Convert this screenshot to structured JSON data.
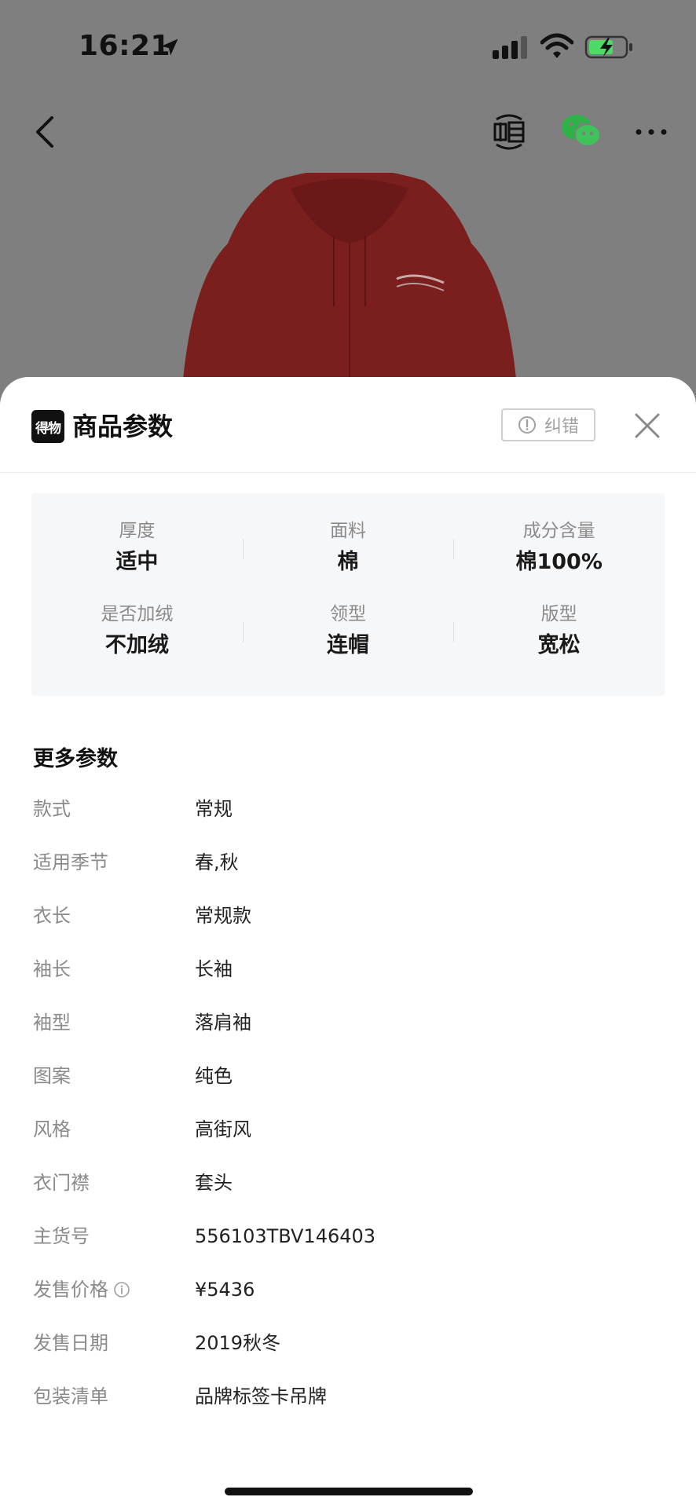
{
  "status_bar": {
    "time": "16:21"
  },
  "sheet": {
    "brand_logo_text": "得物",
    "title": "商品参数",
    "correct_label": "纠错"
  },
  "key_params": [
    {
      "label": "厚度",
      "value": "适中"
    },
    {
      "label": "面料",
      "value": "棉"
    },
    {
      "label": "成分含量",
      "value": "棉100%"
    },
    {
      "label": "是否加绒",
      "value": "不加绒"
    },
    {
      "label": "领型",
      "value": "连帽"
    },
    {
      "label": "版型",
      "value": "宽松"
    }
  ],
  "more_params": {
    "title": "更多参数",
    "items": [
      {
        "label": "款式",
        "value": "常规"
      },
      {
        "label": "适用季节",
        "value": "春,秋"
      },
      {
        "label": "衣长",
        "value": "常规款"
      },
      {
        "label": "袖长",
        "value": "长袖"
      },
      {
        "label": "袖型",
        "value": "落肩袖"
      },
      {
        "label": "图案",
        "value": "纯色"
      },
      {
        "label": "风格",
        "value": "高街风"
      },
      {
        "label": "衣门襟",
        "value": "套头"
      },
      {
        "label": "主货号",
        "value": "556103TBV146403"
      },
      {
        "label": "发售价格",
        "value": "¥5436"
      },
      {
        "label": "发售日期",
        "value": "2019秋冬"
      },
      {
        "label": "包装清单",
        "value": "品牌标签卡吊牌"
      }
    ]
  },
  "colors": {
    "product": "#8a1d1d",
    "sheet_bg": "#ffffff",
    "params_bg": "#f6f7f9"
  }
}
